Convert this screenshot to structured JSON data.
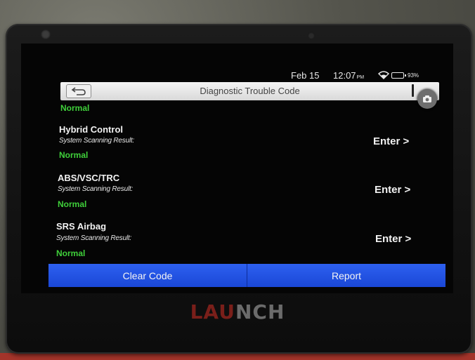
{
  "status_bar": {
    "date": "Feb 15",
    "time": "12:07",
    "ampm": "PM",
    "battery": "93%"
  },
  "header": {
    "title": "Diagnostic Trouble Code",
    "back_icon": "back-arrow-icon",
    "more_icon": "overflow-icon"
  },
  "systems": [
    {
      "name": "",
      "label": "",
      "status": "Normal"
    },
    {
      "name": "Hybrid Control",
      "label": "System Scanning Result:",
      "status": "Normal",
      "action": "Enter >"
    },
    {
      "name": "ABS/VSC/TRC",
      "label": "System Scanning Result:",
      "status": "Normal",
      "action": "Enter >"
    },
    {
      "name": "SRS Airbag",
      "label": "System Scanning Result:",
      "status": "Normal",
      "action": "Enter >"
    }
  ],
  "footer": {
    "clear_code": "Clear Code",
    "report": "Report"
  },
  "brand": {
    "part1": "LAU",
    "part2": "NCH"
  },
  "colors": {
    "status_normal": "#3fcf3a",
    "button_blue": "#1c4fe0",
    "brand_red": "#7a1f1a"
  },
  "icons": {
    "camera": "camera-icon",
    "wifi": "wifi-icon",
    "battery": "battery-icon"
  }
}
